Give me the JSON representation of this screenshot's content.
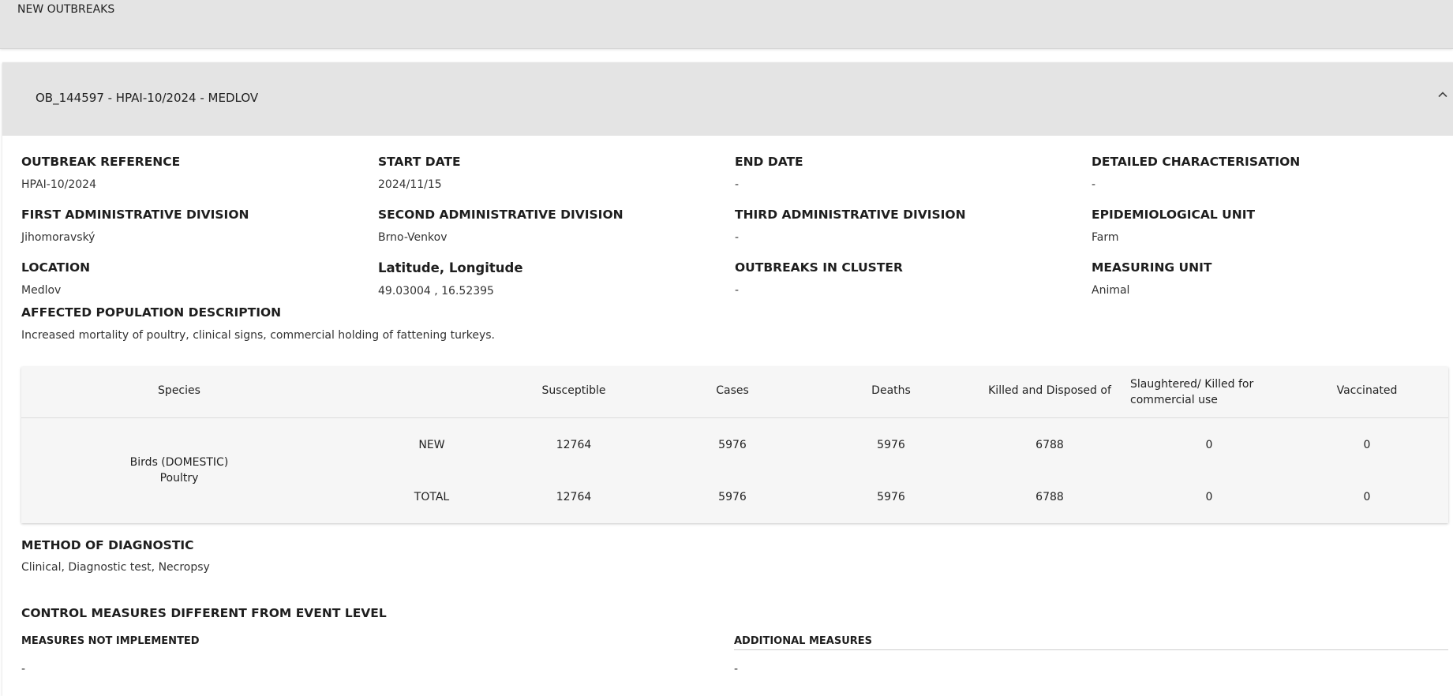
{
  "top_bar": {
    "title": "NEW OUTBREAKS"
  },
  "outbreak": {
    "header_title": "OB_144597 - HPAI-10/2024 - MEDLOV",
    "fields": {
      "outbreak_reference": {
        "label": "OUTBREAK REFERENCE",
        "value": "HPAI-10/2024"
      },
      "start_date": {
        "label": "START DATE",
        "value": "2024/11/15"
      },
      "end_date": {
        "label": "END DATE",
        "value": "-"
      },
      "detailed_characterisation": {
        "label": "DETAILED CHARACTERISATION",
        "value": "-"
      },
      "first_admin_division": {
        "label": "FIRST ADMINISTRATIVE DIVISION",
        "value": "Jihomoravský"
      },
      "second_admin_division": {
        "label": "SECOND ADMINISTRATIVE DIVISION",
        "value": "Brno-Venkov"
      },
      "third_admin_division": {
        "label": "THIRD ADMINISTRATIVE DIVISION",
        "value": "-"
      },
      "epidemiological_unit": {
        "label": "EPIDEMIOLOGICAL UNIT",
        "value": "Farm"
      },
      "location": {
        "label": "LOCATION",
        "value": "Medlov"
      },
      "lat_long": {
        "label": "Latitude, Longitude",
        "value": "49.03004 , 16.52395"
      },
      "outbreaks_in_cluster": {
        "label": "OUTBREAKS IN CLUSTER",
        "value": "-"
      },
      "measuring_unit": {
        "label": "MEASURING UNIT",
        "value": "Animal"
      }
    },
    "affected_population": {
      "label": "AFFECTED POPULATION DESCRIPTION",
      "value": "Increased mortality of poultry, clinical signs, commercial holding of fattening turkeys."
    },
    "species_table": {
      "headers": {
        "species": "Species",
        "susceptible": "Susceptible",
        "cases": "Cases",
        "deaths": "Deaths",
        "killed_disposed": "Killed and Disposed of",
        "slaughtered_line1": "Slaughtered/ Killed for",
        "slaughtered_line2": "commercial use",
        "vaccinated": "Vaccinated"
      },
      "species_line1": "Birds (DOMESTIC)",
      "species_line2": "Poultry",
      "rows": [
        {
          "type": "NEW",
          "susceptible": "12764",
          "cases": "5976",
          "deaths": "5976",
          "killed_disposed": "6788",
          "slaughtered": "0",
          "vaccinated": "0"
        },
        {
          "type": "TOTAL",
          "susceptible": "12764",
          "cases": "5976",
          "deaths": "5976",
          "killed_disposed": "6788",
          "slaughtered": "0",
          "vaccinated": "0"
        }
      ]
    },
    "method_of_diagnostic": {
      "label": "METHOD OF DIAGNOSTIC",
      "value": "Clinical, Diagnostic test, Necropsy"
    },
    "control_measures": {
      "label": "CONTROL MEASURES DIFFERENT FROM EVENT LEVEL",
      "not_implemented_label": "MEASURES NOT IMPLEMENTED",
      "not_implemented_value": "-",
      "additional_label": "ADDITIONAL MEASURES",
      "additional_value": "-"
    }
  }
}
